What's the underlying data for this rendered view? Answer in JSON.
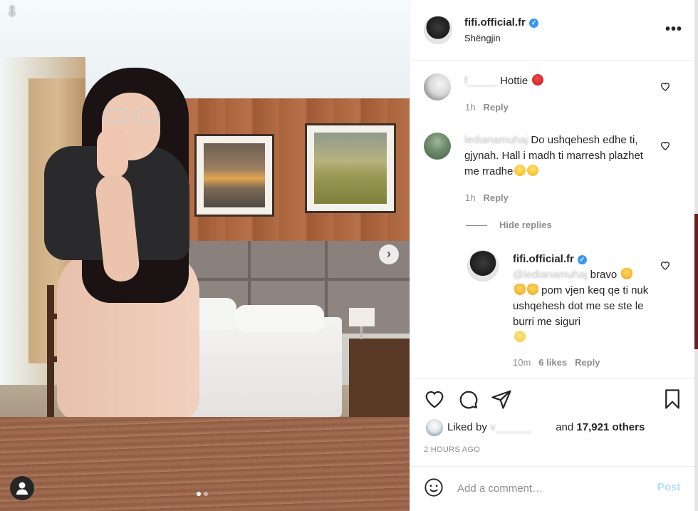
{
  "post": {
    "username": "fifi.official.fr",
    "location": "Shëngjin",
    "carousel_total": 2,
    "carousel_index": 1
  },
  "icons": {
    "download": "download-icon",
    "next": "chevron-right-icon",
    "user_tag": "user-tag-icon",
    "more": "more-options-icon",
    "verified": "verified-badge-icon",
    "like": "heart-icon",
    "comment": "comment-icon",
    "share": "send-icon",
    "save": "bookmark-icon",
    "emoji": "smile-icon"
  },
  "comments": [
    {
      "username_obscured": "f_____",
      "text": "Hottie",
      "time": "1h",
      "reply_label": "Reply"
    },
    {
      "username_obscured": "ledianamuhaj",
      "text": "Do ushqehesh edhe ti, gjynah. Hall i madh ti marresh plazhet me rradhe",
      "time": "1h",
      "reply_label": "Reply",
      "hide_replies_label": "Hide replies",
      "reply": {
        "username": "fifi.official.fr",
        "mention_obscured": "@ledianamuhaj",
        "text_1": "bravo",
        "text_2": "pom vjen keq qe ti nuk ushqehesh dot me se ste le burri me siguri",
        "time": "10m",
        "likes": "6 likes",
        "reply_label": "Reply"
      }
    }
  ],
  "likes": {
    "prefix": "Liked by",
    "liker_obscured": "v______",
    "middle": "and",
    "count": "17,921 others"
  },
  "timestamp": "2 HOURS AGO",
  "add_comment": {
    "placeholder": "Add a comment…",
    "post_label": "Post"
  },
  "colors": {
    "verified": "#3897f0",
    "post_disabled": "#b2dffc",
    "secondary_text": "#8e8e8e",
    "primary_text": "#262626"
  }
}
